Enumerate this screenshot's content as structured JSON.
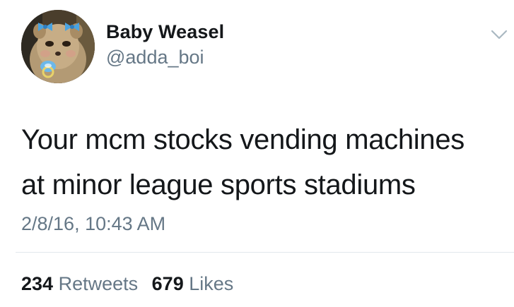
{
  "user": {
    "display_name": "Baby Weasel",
    "handle": "@adda_boi",
    "avatar_icon": "weasel-with-bows-and-pacifier"
  },
  "tweet": {
    "lines": [
      "Your mcm stocks vending machines",
      "at minor league sports stadiums"
    ],
    "timestamp": "2/8/16, 10:43 AM"
  },
  "stats": {
    "retweets_count": "234",
    "retweets_label": "Retweets",
    "likes_count": "679",
    "likes_label": "Likes"
  },
  "colors": {
    "text_primary": "#14171a",
    "text_secondary": "#657786",
    "divider": "#e1e8ed",
    "bow_blue": "#4aa3e0"
  }
}
